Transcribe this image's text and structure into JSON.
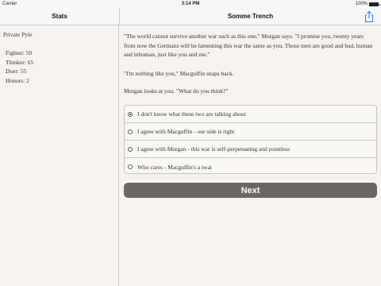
{
  "status_bar": {
    "carrier": "Carrier",
    "time": "3:14 PM",
    "battery_text": "100%",
    "battery_level": 1.0
  },
  "nav": {
    "left_title": "Stats",
    "right_title": "Somme Trench"
  },
  "sidebar": {
    "name": "Private Pyle",
    "stats": [
      "Fighter: 50",
      "Thinker: 65",
      "Doer: 55",
      "Honors: 2"
    ]
  },
  "story": {
    "paragraphs": [
      "\"The world cannot survive another war such as this one,\" Morgan says. \"I promise you, twenty years from now the Germans will be lamenting this war the same as you. Those men are good and bad, human and inhuman, just like you and me.\"",
      "\"I'm nothing like you,\" Macguffin snaps back.",
      "Morgan looks at you. \"What do you think?\""
    ]
  },
  "choices": [
    {
      "label": "I don't know what these two are talking about",
      "selected": true
    },
    {
      "label": "I agree with Macguffin - our side is right",
      "selected": false
    },
    {
      "label": "I agree with Morgan - this war is self-perpetuating and pointless",
      "selected": false
    },
    {
      "label": "Who cares - Macguffin's a twat",
      "selected": false
    }
  ],
  "next_button": {
    "label": "Next"
  },
  "colors": {
    "accent": "#1a7ee0",
    "button_bg": "#6b6764",
    "background": "#f6f2ee"
  }
}
